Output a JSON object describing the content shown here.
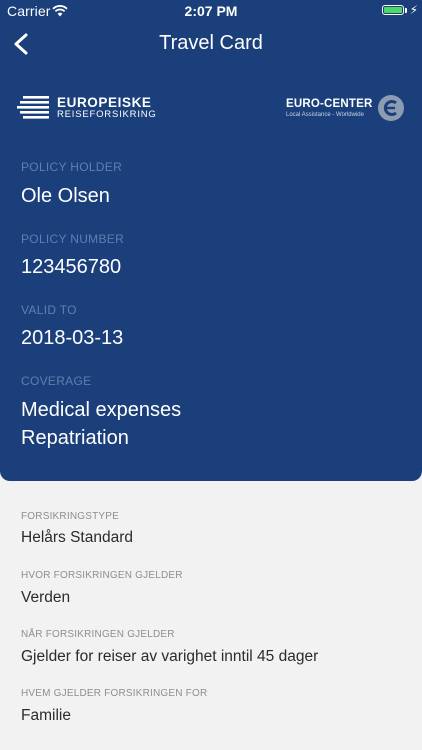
{
  "status_bar": {
    "carrier": "Carrier",
    "time": "2:07 PM",
    "battery_color": "#4cd964"
  },
  "nav": {
    "title": "Travel Card",
    "back_icon": "chevron-left-icon"
  },
  "logos": {
    "left": {
      "main": "EUROPEISKE",
      "sub": "REISEFORSIKRING"
    },
    "right": {
      "main": "EURO-CENTER",
      "sub": "Local Assistance - Worldwide"
    }
  },
  "card": {
    "background": "#1b3f7a",
    "policy_holder": {
      "label": "POLICY HOLDER",
      "value": "Ole Olsen"
    },
    "policy_number": {
      "label": "POLICY NUMBER",
      "value": "123456780"
    },
    "valid_to": {
      "label": "VALID TO",
      "value": "2018-03-13"
    },
    "coverage": {
      "label": "COVERAGE",
      "items": [
        "Medical expenses",
        "Repatriation"
      ]
    }
  },
  "details": [
    {
      "label": "FORSIKRINGSTYPE",
      "value": "Helårs Standard"
    },
    {
      "label": "HVOR FORSIKRINGEN GJELDER",
      "value": "Verden"
    },
    {
      "label": "NÅR FORSIKRINGEN GJELDER",
      "value": "Gjelder for reiser av varighet inntil 45 dager"
    },
    {
      "label": "HVEM GJELDER FORSIKRINGEN FOR",
      "value": "Familie"
    }
  ]
}
